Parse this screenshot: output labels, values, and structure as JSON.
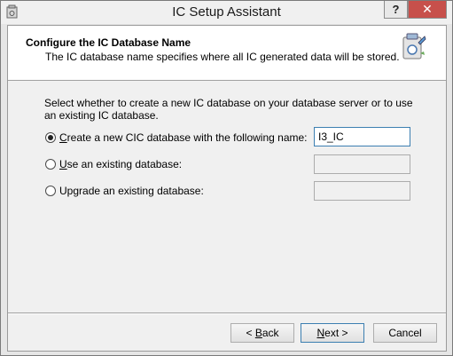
{
  "window": {
    "title": "IC Setup Assistant",
    "help_label": "?",
    "close_label": "✕"
  },
  "header": {
    "title": "Configure the IC Database Name",
    "subtitle": "The IC database name specifies where all IC generated data will be stored."
  },
  "body": {
    "intro": "Select whether to create a new IC database on your database server or to use an existing IC database.",
    "options": [
      {
        "label_key": "C",
        "label_rest": "reate a new CIC database with the following name:",
        "selected": true,
        "value": "I3_IC"
      },
      {
        "label_key": "U",
        "label_rest": "se an existing database:",
        "selected": false,
        "value": ""
      },
      {
        "label_pre": "Up",
        "label_key": "g",
        "label_rest": "rade an existing database:",
        "selected": false,
        "value": ""
      }
    ]
  },
  "buttons": {
    "back": {
      "prefix": "< ",
      "key": "B",
      "rest": "ack"
    },
    "next": {
      "key": "N",
      "rest": "ext >"
    },
    "cancel": "Cancel"
  },
  "colors": {
    "close_button": "#c7504b",
    "focus_border": "#3c7fb1"
  }
}
